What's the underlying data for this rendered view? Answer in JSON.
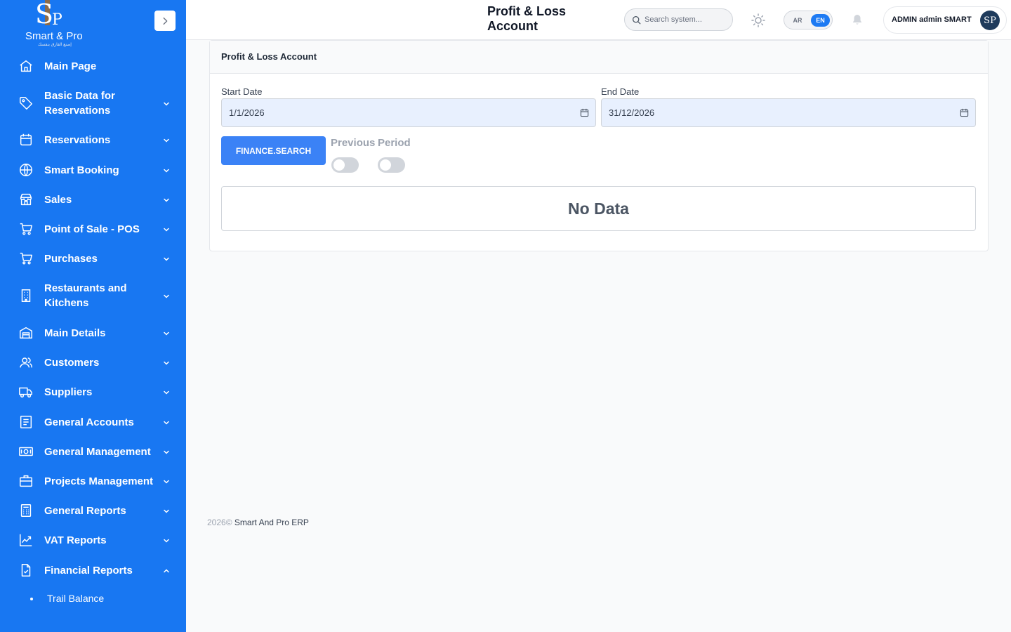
{
  "sidebar": {
    "logo": {
      "letters_s": "S",
      "letters_p": "P",
      "brand": "Smart & Pro",
      "tagline": "إصنع الفارق بنفسك"
    },
    "items": [
      {
        "label": "Main Page",
        "icon": "home-icon",
        "has_chevron": false
      },
      {
        "label": "Basic Data for Reservations",
        "icon": "tag-icon",
        "has_chevron": true,
        "expanded": false
      },
      {
        "label": "Reservations",
        "icon": "calendar-icon",
        "has_chevron": true,
        "expanded": false
      },
      {
        "label": "Smart Booking",
        "icon": "globe-icon",
        "has_chevron": true,
        "expanded": false
      },
      {
        "label": "Sales",
        "icon": "store-icon",
        "has_chevron": true,
        "expanded": false
      },
      {
        "label": "Point of Sale - POS",
        "icon": "cart-icon",
        "has_chevron": true,
        "expanded": false
      },
      {
        "label": "Purchases",
        "icon": "cart-icon",
        "has_chevron": true,
        "expanded": false
      },
      {
        "label": "Restaurants and Kitchens",
        "icon": "building-icon",
        "has_chevron": true,
        "expanded": false
      },
      {
        "label": "Main Details",
        "icon": "warehouse-icon",
        "has_chevron": true,
        "expanded": false
      },
      {
        "label": "Customers",
        "icon": "users-icon",
        "has_chevron": true,
        "expanded": false
      },
      {
        "label": "Suppliers",
        "icon": "truck-icon",
        "has_chevron": true,
        "expanded": false
      },
      {
        "label": "General Accounts",
        "icon": "ledger-icon",
        "has_chevron": true,
        "expanded": false
      },
      {
        "label": "General Management",
        "icon": "money-icon",
        "has_chevron": true,
        "expanded": false
      },
      {
        "label": "Projects Management",
        "icon": "briefcase-icon",
        "has_chevron": true,
        "expanded": false
      },
      {
        "label": "General Reports",
        "icon": "calculator-icon",
        "has_chevron": true,
        "expanded": false
      },
      {
        "label": "VAT Reports",
        "icon": "trend-icon",
        "has_chevron": true,
        "expanded": false
      },
      {
        "label": "Financial Reports",
        "icon": "report-icon",
        "has_chevron": true,
        "expanded": true
      }
    ],
    "sub_item": {
      "label": "Trail Balance"
    }
  },
  "header": {
    "title": "Profit & Loss Account",
    "search_placeholder": "Search system...",
    "lang_ar": "AR",
    "lang_en": "EN",
    "active_lang": "EN",
    "user_name": "ADMIN admin SMART",
    "avatar_text": "SP"
  },
  "card": {
    "title": "Profit & Loss Account",
    "start_label": "Start Date",
    "start_value": "1/1/2026",
    "end_label": "End Date",
    "end_value": "31/12/2026",
    "search_button": "FINANCE.SEARCH",
    "toggle_previous": "Previous",
    "toggle_period": "Period",
    "toggle_previous_on": false,
    "toggle_period_on": false,
    "empty": "No Data"
  },
  "footer": {
    "year": "2026©",
    "text": "Smart And Pro ERP"
  },
  "colors": {
    "sidebar": "#1877f2",
    "accent": "#3b82f6",
    "lang_active": "#1d7af3"
  }
}
